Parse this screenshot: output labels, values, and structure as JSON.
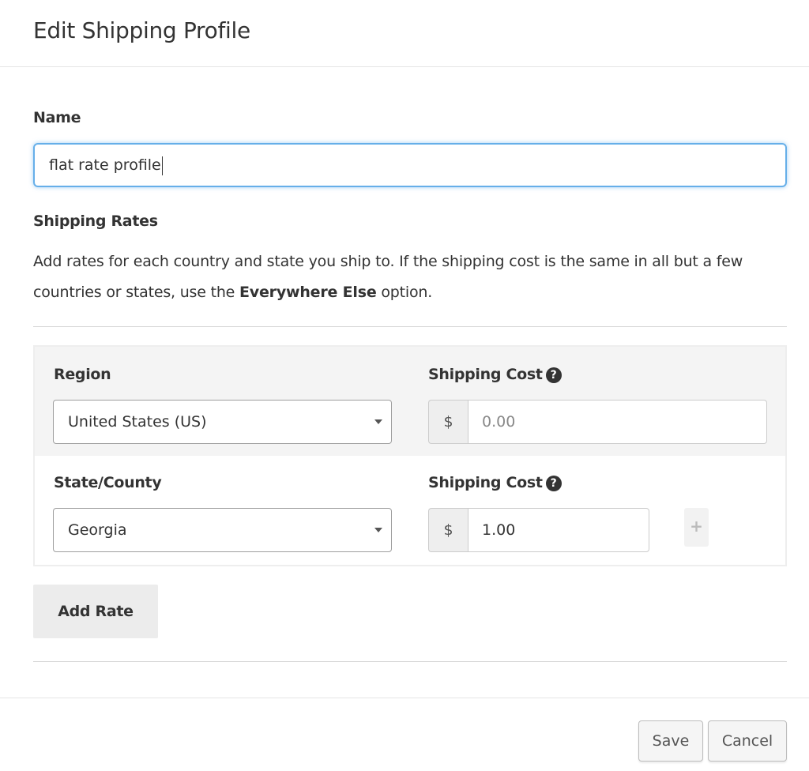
{
  "modal": {
    "title": "Edit Shipping Profile"
  },
  "name_field": {
    "label": "Name",
    "value": "flat rate profile"
  },
  "shipping_rates": {
    "heading": "Shipping Rates",
    "help_prefix": "Add rates for each country and state you ship to. If the shipping cost is the same in all but a few countries or states, use the ",
    "help_bold": "Everywhere Else",
    "help_suffix": " option."
  },
  "region_row": {
    "region_label": "Region",
    "region_value": "United States (US)",
    "cost_label": "Shipping Cost",
    "currency": "$",
    "cost_placeholder": "0.00"
  },
  "state_row": {
    "state_label": "State/County",
    "state_value": "Georgia",
    "cost_label": "Shipping Cost",
    "currency": "$",
    "cost_value": "1.00",
    "add_symbol": "+"
  },
  "actions": {
    "add_rate": "Add Rate",
    "save": "Save",
    "cancel": "Cancel"
  },
  "icons": {
    "help": "question-circle-icon",
    "dropdown": "caret-down-icon",
    "add": "plus-icon"
  },
  "colors": {
    "focus_border": "#66afe9",
    "row_shading": "#f4f4f4",
    "button_bg": "#ececec"
  }
}
